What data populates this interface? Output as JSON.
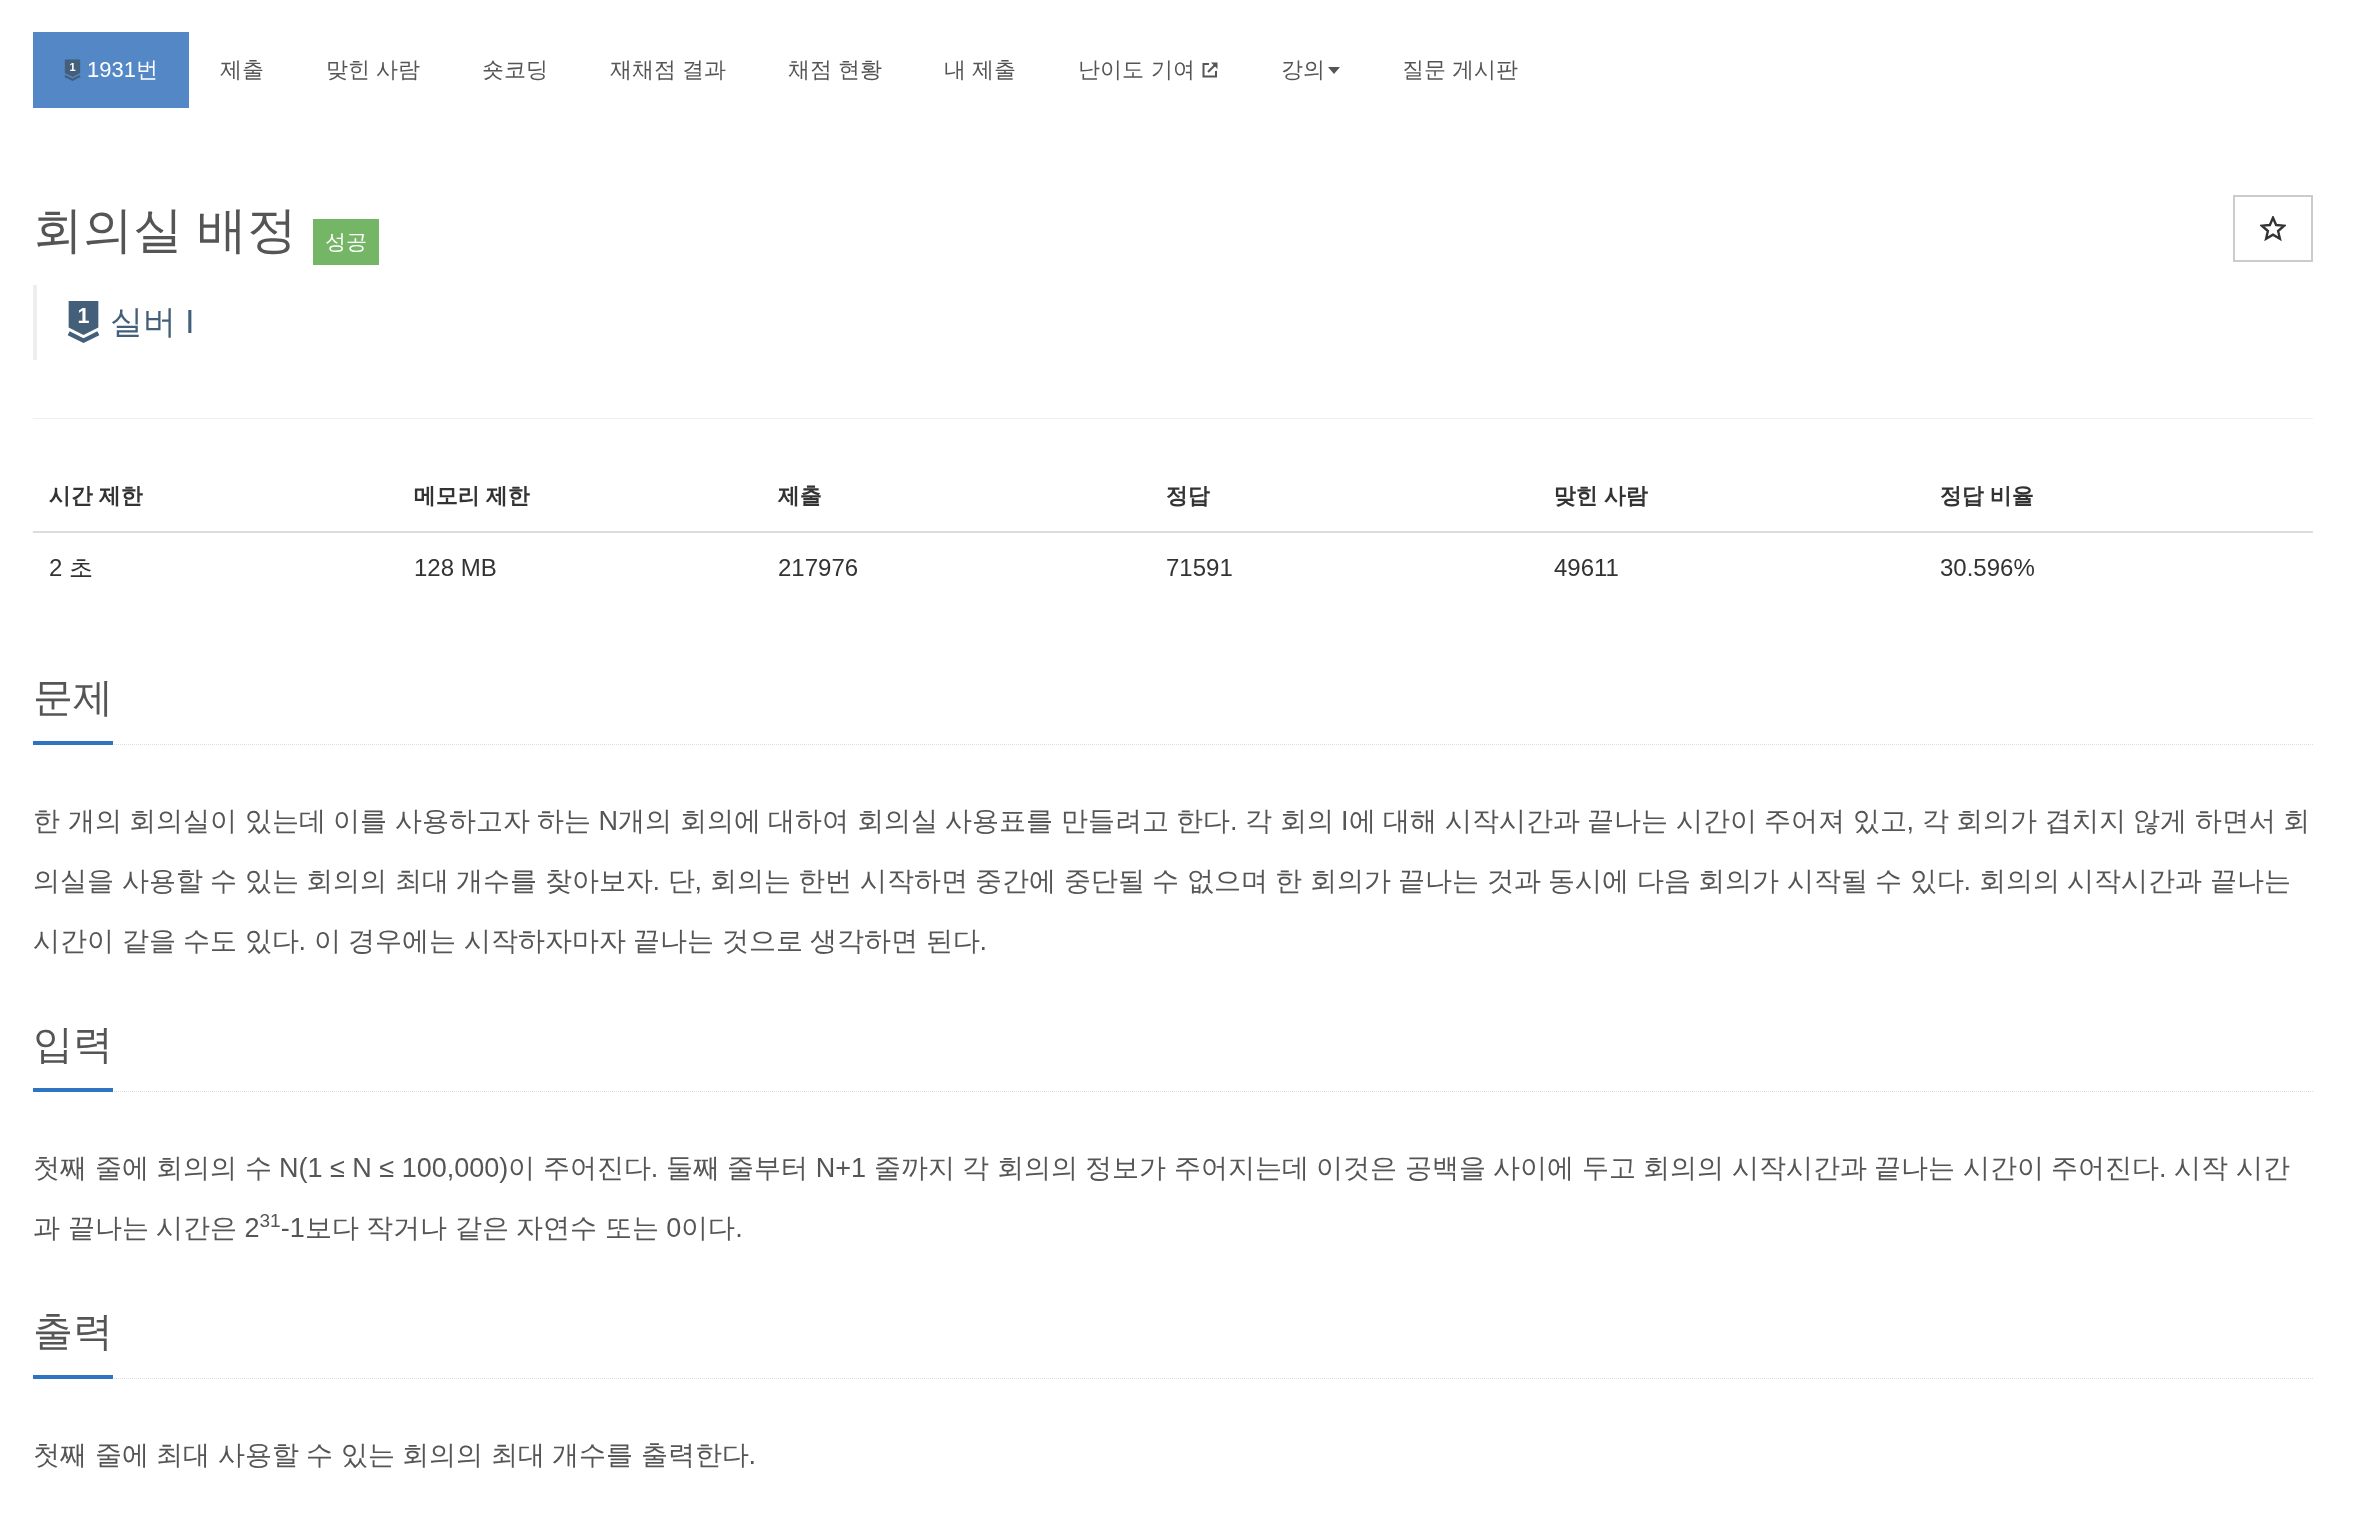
{
  "tabs": [
    {
      "label": "1931번",
      "kind": "problem",
      "tier_number": "1",
      "selected": true
    },
    {
      "label": "제출",
      "kind": "plain",
      "selected": false
    },
    {
      "label": "맞힌 사람",
      "kind": "plain",
      "selected": false
    },
    {
      "label": "숏코딩",
      "kind": "plain",
      "selected": false
    },
    {
      "label": "재채점 결과",
      "kind": "plain",
      "selected": false
    },
    {
      "label": "채점 현황",
      "kind": "plain",
      "selected": false
    },
    {
      "label": "내 제출",
      "kind": "plain",
      "selected": false
    },
    {
      "label": "난이도 기여",
      "kind": "external",
      "selected": false
    },
    {
      "label": "강의",
      "kind": "dropdown",
      "selected": false
    },
    {
      "label": "질문 게시판",
      "kind": "plain",
      "selected": false
    }
  ],
  "problem": {
    "title": "회의실 배정",
    "result_badge": "성공",
    "starred": false,
    "tier": {
      "number": "1",
      "label": "실버 I"
    }
  },
  "info_table": {
    "columns": [
      "시간 제한",
      "메모리 제한",
      "제출",
      "정답",
      "맞힌 사람",
      "정답 비율"
    ],
    "rows": [
      [
        "2 초",
        "128 MB",
        "217976",
        "71591",
        "49611",
        "30.596%"
      ]
    ]
  },
  "sections": [
    {
      "heading": "문제",
      "paragraphs": [
        "한 개의 회의실이 있는데 이를 사용하고자 하는 N개의 회의에 대하여 회의실 사용표를 만들려고 한다. 각 회의 I에 대해 시작시간과 끝나는 시간이 주어져 있고, 각 회의가 겹치지 않게 하면서 회의실을 사용할 수 있는 회의의 최대 개수를 찾아보자. 단, 회의는 한번 시작하면 중간에 중단될 수 없으며 한 회의가 끝나는 것과 동시에 다음 회의가 시작될 수 있다. 회의의 시작시간과 끝나는 시간이 같을 수도 있다. 이 경우에는 시작하자마자 끝나는 것으로 생각하면 된다."
      ]
    },
    {
      "heading": "입력",
      "paragraphs": [
        "첫째 줄에 회의의 수 N(1 ≤ N ≤ 100,000)이 주어진다. 둘째 줄부터 N+1 줄까지 각 회의의 정보가 주어지는데 이것은 공백을 사이에 두고 회의의 시작시간과 끝나는 시간이 주어진다. 시작 시간과 끝나는 시간은 2$^{31}$-1보다 작거나 같은 자연수 또는 0이다."
      ]
    },
    {
      "heading": "출력",
      "paragraphs": [
        "첫째 줄에 최대 사용할 수 있는 회의의 최대 개수를 출력한다."
      ]
    }
  ]
}
